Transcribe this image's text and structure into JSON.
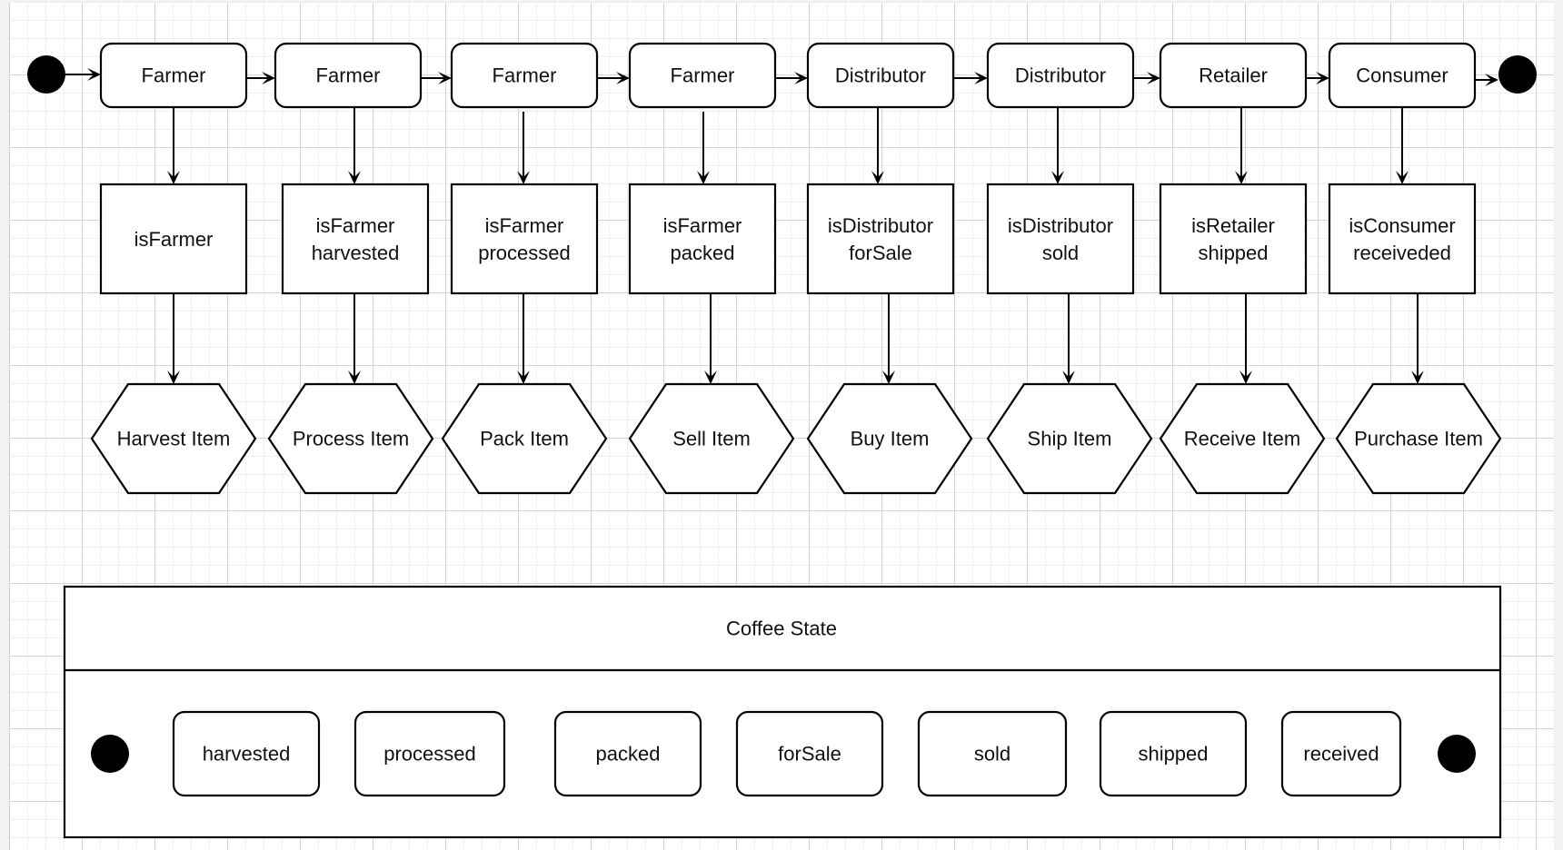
{
  "diagram": {
    "actors": [
      {
        "actor": "Farmer",
        "role_check": [
          "isFarmer"
        ],
        "action": "Harvest Item"
      },
      {
        "actor": "Farmer",
        "role_check": [
          "isFarmer",
          "harvested"
        ],
        "action": "Process Item"
      },
      {
        "actor": "Farmer",
        "role_check": [
          "isFarmer",
          "processed"
        ],
        "action": "Pack Item"
      },
      {
        "actor": "Farmer",
        "role_check": [
          "isFarmer",
          "packed"
        ],
        "action": "Sell Item"
      },
      {
        "actor": "Distributor",
        "role_check": [
          "isDistributor",
          "forSale"
        ],
        "action": "Buy Item"
      },
      {
        "actor": "Distributor",
        "role_check": [
          "isDistributor",
          "sold"
        ],
        "action": "Ship Item"
      },
      {
        "actor": "Retailer",
        "role_check": [
          "isRetailer",
          "shipped"
        ],
        "action": "Receive Item"
      },
      {
        "actor": "Consumer",
        "role_check": [
          "isConsumer",
          "receiveded"
        ],
        "action": "Purchase Item"
      }
    ],
    "state_machine": {
      "title": "Coffee State",
      "states": [
        "harvested",
        "processed",
        "packed",
        "forSale",
        "sold",
        "shipped",
        "received"
      ]
    }
  }
}
